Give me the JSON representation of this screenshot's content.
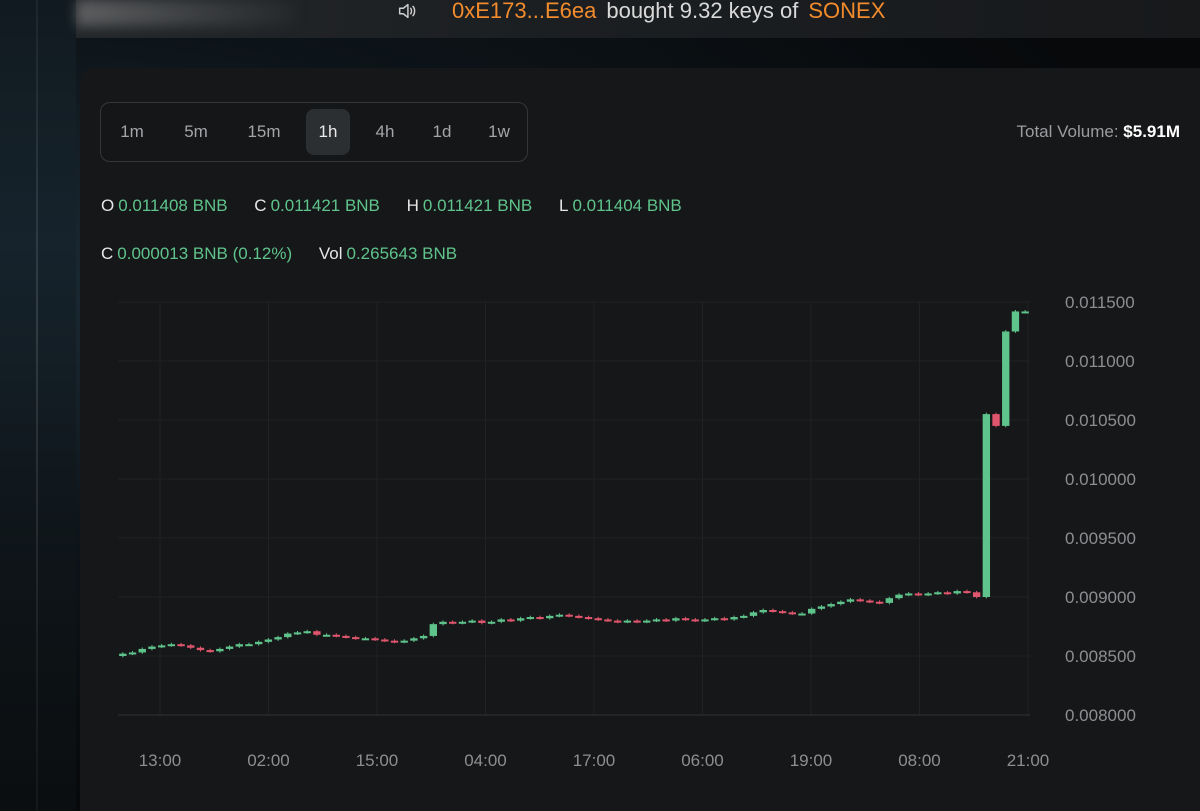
{
  "ticker": {
    "address": "0xE173...E6ea",
    "action": "bought 9.32 keys of",
    "brand": "SONEX",
    "speaker_icon": "speaker-icon"
  },
  "timeframes": [
    "1m",
    "5m",
    "15m",
    "1h",
    "4h",
    "1d",
    "1w"
  ],
  "active_timeframe": "1h",
  "volume": {
    "label": "Total Volume:",
    "value": "$5.91M"
  },
  "ohlc": {
    "open_label": "O",
    "open": "0.011408 BNB",
    "close_label": "C",
    "close": "0.011421 BNB",
    "high_label": "H",
    "high": "0.011421 BNB",
    "low_label": "L",
    "low": "0.011404 BNB",
    "change_label": "C",
    "change": "0.000013 BNB (0.12%)",
    "vol_label": "Vol",
    "vol": "0.265643 BNB"
  },
  "colors": {
    "up": "#5fc48c",
    "down": "#e0566e",
    "accent": "#f28b2c"
  },
  "chart_data": {
    "type": "candlestick",
    "y_ticks": [
      "0.011500",
      "0.011000",
      "0.010500",
      "0.010000",
      "0.009500",
      "0.009000",
      "0.008500",
      "0.008000"
    ],
    "x_ticks": [
      "13:00",
      "02:00",
      "15:00",
      "04:00",
      "17:00",
      "06:00",
      "19:00",
      "08:00",
      "21:00"
    ],
    "ylim": [
      0.008,
      0.0115
    ],
    "closes": [
      0.00852,
      0.00853,
      0.00856,
      0.00858,
      0.00859,
      0.0086,
      0.00859,
      0.00857,
      0.00855,
      0.00854,
      0.00856,
      0.00858,
      0.0086,
      0.0086,
      0.00862,
      0.00864,
      0.00866,
      0.00869,
      0.0087,
      0.00871,
      0.00868,
      0.00868,
      0.00867,
      0.00866,
      0.00865,
      0.00865,
      0.00864,
      0.00863,
      0.00862,
      0.00863,
      0.00865,
      0.00867,
      0.00877,
      0.00879,
      0.00878,
      0.00879,
      0.0088,
      0.00878,
      0.00879,
      0.00881,
      0.0088,
      0.00882,
      0.00883,
      0.00882,
      0.00884,
      0.00885,
      0.00884,
      0.00883,
      0.00882,
      0.00881,
      0.0088,
      0.00879,
      0.0088,
      0.00879,
      0.0088,
      0.00881,
      0.0088,
      0.00882,
      0.00881,
      0.0088,
      0.00881,
      0.00882,
      0.00881,
      0.00883,
      0.00884,
      0.00887,
      0.00889,
      0.00888,
      0.00887,
      0.00886,
      0.00886,
      0.0089,
      0.00892,
      0.00894,
      0.00896,
      0.00898,
      0.00897,
      0.00896,
      0.00895,
      0.00899,
      0.00902,
      0.00903,
      0.00902,
      0.00903,
      0.00904,
      0.00903,
      0.00905,
      0.00904,
      0.009,
      0.01055,
      0.01045,
      0.01125,
      0.01142,
      0.01142
    ]
  }
}
